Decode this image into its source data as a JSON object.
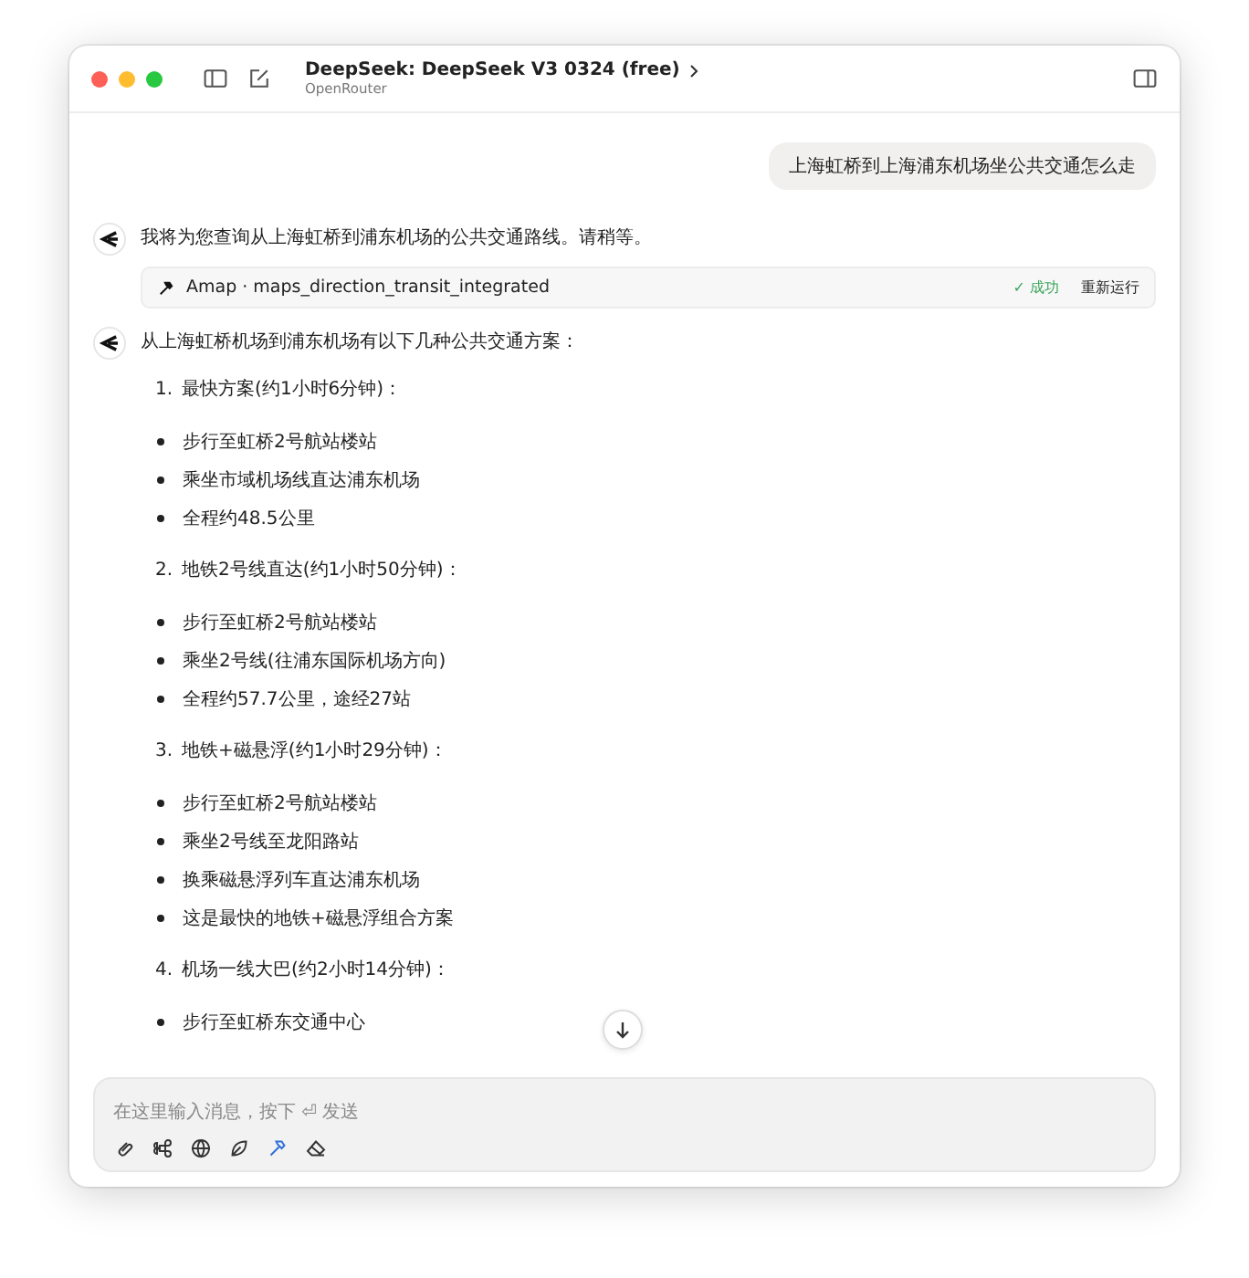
{
  "window": {
    "title": "DeepSeek: DeepSeek V3 0324 (free)",
    "subtitle": "OpenRouter"
  },
  "messages": [
    {
      "kind": "user",
      "text": "上海虹桥到上海浦东机场坐公共交通怎么走"
    },
    {
      "kind": "assistant",
      "text": "我将为您查询从上海虹桥到浦东机场的公共交通路线。请稍等。",
      "tool_call": {
        "name": "Amap · maps_direction_transit_integrated",
        "status": "✓ 成功",
        "rerun": "重新运行"
      }
    },
    {
      "kind": "assistant",
      "text": "从上海虹桥机场到浦东机场有以下几种公共交通方案：",
      "sections": [
        {
          "number": "1.",
          "title": "最快方案(约1小时6分钟)：",
          "bullets": [
            "步行至虹桥2号航站楼站",
            "乘坐市域机场线直达浦东机场",
            "全程约48.5公里"
          ]
        },
        {
          "number": "2.",
          "title": "地铁2号线直达(约1小时50分钟)：",
          "bullets": [
            "步行至虹桥2号航站楼站",
            "乘坐2号线(往浦东国际机场方向)",
            "全程约57.7公里，途经27站"
          ]
        },
        {
          "number": "3.",
          "title": "地铁+磁悬浮(约1小时29分钟)：",
          "bullets": [
            "步行至虹桥2号航站楼站",
            "乘坐2号线至龙阳路站",
            "换乘磁悬浮列车直达浦东机场",
            "这是最快的地铁+磁悬浮组合方案"
          ]
        },
        {
          "number": "4.",
          "title": "机场一线大巴(约2小时14分钟)：",
          "bullets": [
            "步行至虹桥东交通中心"
          ]
        }
      ]
    }
  ],
  "composer": {
    "placeholder": "在这里输入消息，按下 ⏎ 发送",
    "tools": [
      {
        "kind": "attach",
        "selected": false
      },
      {
        "kind": "command",
        "selected": false
      },
      {
        "kind": "globe",
        "selected": false
      },
      {
        "kind": "leaf",
        "selected": false
      },
      {
        "kind": "hammer",
        "selected": true
      },
      {
        "kind": "eraser",
        "selected": false
      }
    ]
  }
}
